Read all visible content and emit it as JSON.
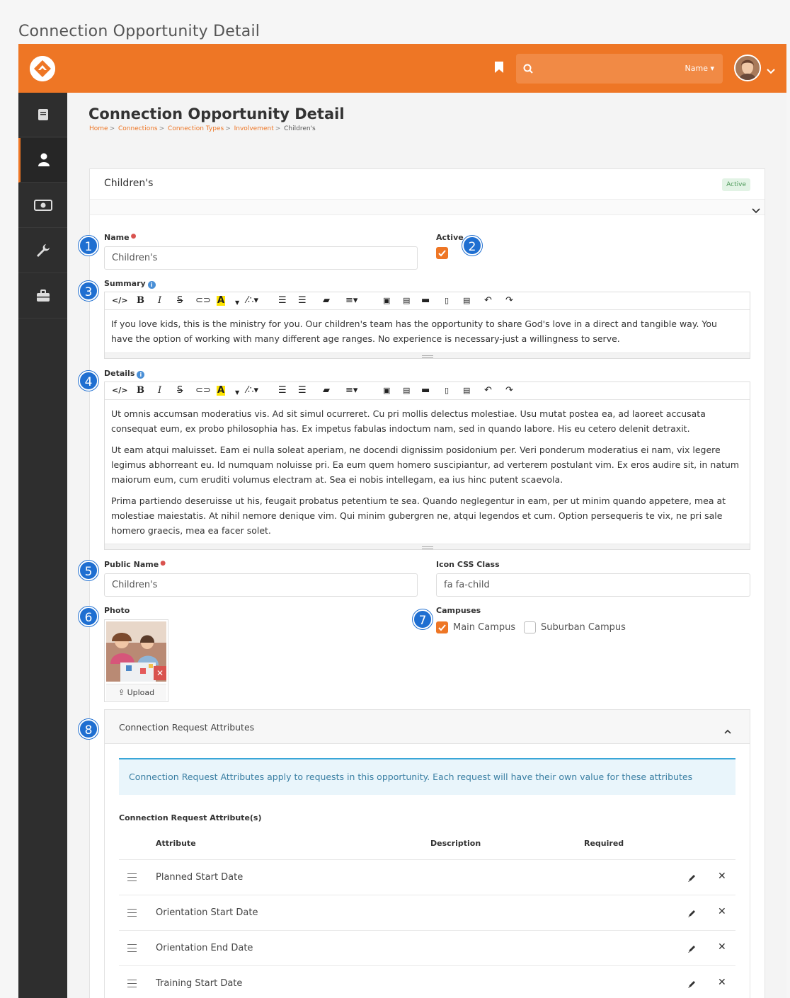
{
  "document": {
    "title": "Connection Opportunity Detail"
  },
  "header": {
    "search_placeholder": "",
    "search_filter": "Name ▾"
  },
  "page": {
    "title": "Connection Opportunity Detail",
    "breadcrumb": [
      "Home",
      "Connections",
      "Connection Types",
      "Involvement",
      "Children's"
    ]
  },
  "panel": {
    "title": "Children's",
    "status_badge": "Active"
  },
  "form": {
    "name_label": "Name",
    "name_value": "Children's",
    "active_label": "Active",
    "active_checked": true,
    "summary_label": "Summary",
    "summary_text": "If you love kids, this is the ministry for you. Our children's team has the opportunity to share God's love in a direct and tangible way. You have the option of working with many different age ranges. No experience is necessary-just a willingness to serve.",
    "details_label": "Details",
    "details_paragraphs": [
      "Ut omnis accumsan moderatius vis. Ad sit simul ocurreret. Cu pri mollis delectus molestiae. Usu mutat postea ea, ad laoreet accusata consequat eum, ex probo philosophia has. Ex impetus fabulas indoctum nam, sed in quando labore. His eu cetero delenit detraxit.",
      "Ut eam atqui maluisset. Eam ei nulla soleat aperiam, ne docendi dignissim posidonium per. Veri ponderum moderatius ei nam, vix legere legimus abhorreant eu. Id numquam noluisse pri. Ea eum quem homero suscipiantur, ad verterem postulant vim. Ex eros audire sit, in natum maiorum eum, cum eruditi volumus electram at. Sea ei nobis intellegam, ea ius hinc putent scaevola.",
      "Prima partiendo deseruisse ut his, feugait probatus petentium te sea. Quando neglegentur in eam, per ut minim quando appetere, mea at molestiae maiestatis. At nihil nemore denique vim. Qui minim gubergren ne, atqui legendos et cum. Option persequeris te vix, ne pri sale homero graecis, mea ea facer solet."
    ],
    "public_name_label": "Public Name",
    "public_name_value": "Children's",
    "icon_css_label": "Icon CSS Class",
    "icon_css_value": "fa fa-child",
    "photo_label": "Photo",
    "upload_label": "Upload",
    "campuses_label": "Campuses",
    "campuses": [
      {
        "name": "Main Campus",
        "checked": true
      },
      {
        "name": "Suburban Campus",
        "checked": false
      }
    ]
  },
  "attributes": {
    "panel_title": "Connection Request Attributes",
    "alert": "Connection Request Attributes apply to requests in this opportunity. Each request will have their own value for these attributes",
    "subtitle": "Connection Request Attribute(s)",
    "columns": [
      "Attribute",
      "Description",
      "Required"
    ],
    "rows": [
      {
        "name": "Planned Start Date"
      },
      {
        "name": "Orientation Start Date"
      },
      {
        "name": "Orientation End Date"
      },
      {
        "name": "Training Start Date"
      }
    ]
  },
  "callouts": [
    "1",
    "2",
    "3",
    "4",
    "5",
    "6",
    "7",
    "8"
  ],
  "colors": {
    "brand_orange": "#ee7625",
    "sidebar": "#2e2e2e",
    "callout_blue": "#1f6fd1",
    "alert_blue": "#3aa6d8"
  }
}
